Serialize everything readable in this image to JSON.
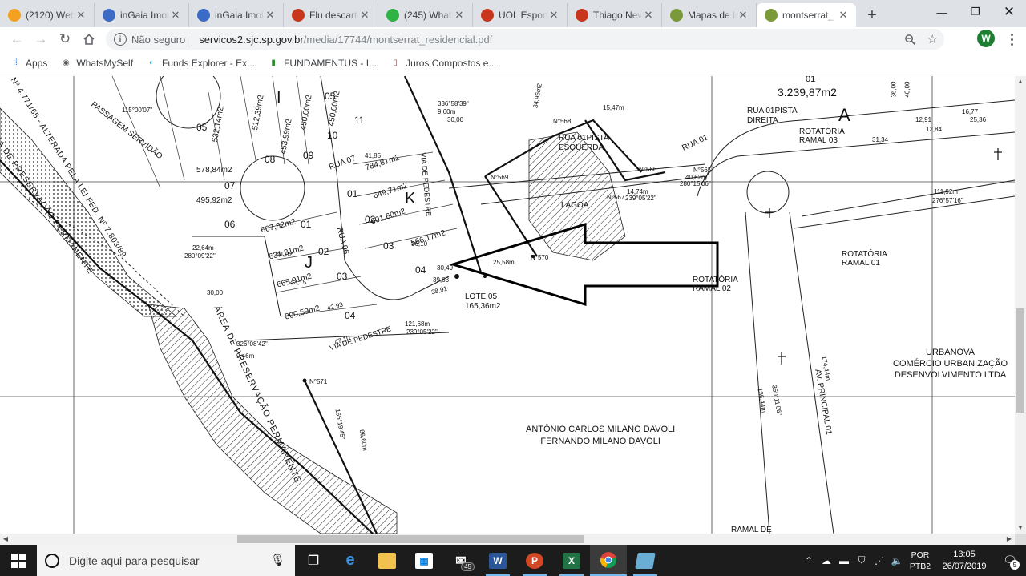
{
  "tabs": [
    {
      "title": "(2120) Web",
      "icon": "mail-icon",
      "color": "#f4a020"
    },
    {
      "title": "inGaia Imob",
      "icon": "ingaia-icon",
      "color": "#3b6bc4"
    },
    {
      "title": "inGaia Imob",
      "icon": "ingaia-icon",
      "color": "#3b6bc4"
    },
    {
      "title": "Flu descarta",
      "icon": "uol-icon",
      "color": "#c8361e"
    },
    {
      "title": "(245) Whats",
      "icon": "whatsapp-icon",
      "color": "#2fb344"
    },
    {
      "title": "UOL Esporte",
      "icon": "uol-icon",
      "color": "#c8361e"
    },
    {
      "title": "Thiago Neve",
      "icon": "uol-icon",
      "color": "#c8361e"
    },
    {
      "title": "Mapas de lo",
      "icon": "map-icon",
      "color": "#7a9a3a"
    },
    {
      "title": "montserrat_",
      "icon": "pdf-map-icon",
      "color": "#7a9a3a",
      "active": true
    }
  ],
  "omnibox": {
    "security": "Não seguro",
    "host": "servicos2.sjc.sp.gov.br",
    "path": "/media/17744/montserrat_residencial.pdf"
  },
  "profile_initial": "W",
  "bookmarks": [
    {
      "label": "Apps",
      "icon": "apps-grid-icon"
    },
    {
      "label": "WhatsMySelf",
      "icon": "whatsmyself-icon"
    },
    {
      "label": "Funds Explorer - Ex...",
      "icon": "funds-explorer-icon"
    },
    {
      "label": "FUNDAMENTUS - I...",
      "icon": "fundamentus-icon"
    },
    {
      "label": "Juros Compostos e...",
      "icon": "juros-icon"
    }
  ],
  "plan": {
    "area_top": "3.239,87m2",
    "label_01": "01",
    "block_A": "A",
    "block_I": "I",
    "block_J": "J",
    "block_K": "K",
    "rua01_pista_direita": "RUA 01PISTA\nDIREITA",
    "rua01_pista_esquerda": "RUA 01PISTA\nESQUERDA",
    "rua07": "RUA 07",
    "rua01": "RUA 01",
    "rua06": "RUA 06",
    "rotatoria_ramal03": "ROTATÓRIA\nRAMAL 03",
    "rotatoria_ramal01": "ROTATÓRIA\nRAMAL 01",
    "rotatoria_ramal02": "ROTATÓRIA\nRAMAL 02",
    "ramal_de": "RAMAL DE",
    "lagoa": "LAGOA",
    "lote05": "LOTE 05\n165,36m2",
    "urbanova": "URBANOVA\nCOMÉRCIO URBANIZAÇÃO\nDESENVOLVIMENTO LTDA",
    "owners": "ANTÔNIO CARLOS MILANO DAVOLI\nFERNANDO MILANO DAVOLI",
    "area_preservacao_1": "ÁREA DE PRESERVAÇÃO PERMANENTE",
    "area_preservacao_2": "ÁREA DE PRESERVAÇÃO PERMANENTE",
    "lei_fed": "Nº 4.771/65 - ALTERADA PELA LEI FED. Nº 7.803/89",
    "passagem": "PASSAGEM SERVIDÃO",
    "av_principal": "AV. PRINCIPAL 01",
    "via_pedestre_1": "VIA DE PEDESTRE",
    "via_pedestre_2": "VIA DE PEDESTRE",
    "lot_areas": [
      "578,84m2",
      "495,92m2",
      "532,14m2",
      "512,39m2",
      "450,00m2",
      "450,00m2",
      "453,99m2",
      "784,81m2",
      "649,71m2",
      "601,60m2",
      "566,17m2",
      "667,82m2",
      "631,31m2",
      "665,91m2",
      "800,59m2"
    ],
    "lot_numbers": [
      "05",
      "07",
      "06",
      "10",
      "09",
      "08",
      "11",
      "01",
      "02",
      "03",
      "04",
      "01",
      "02",
      "03",
      "04",
      "05"
    ],
    "marcos": [
      "N°568",
      "N°569",
      "N°570",
      "N°571",
      "N°566",
      "N°565",
      "N°567"
    ],
    "dims": [
      "3.239,87m2",
      "34,96m2",
      "111,92m",
      "276°57'16\"",
      "115°00'07\"",
      "280°09'22\"",
      "22,64m",
      "30,00",
      "326°08'42\"",
      "9,46m",
      "121,68m",
      "239°05'22\"",
      "25,58m",
      "165°19'45\"",
      "86,60m",
      "136,44m",
      "350°11'06\"",
      "174,44m",
      "40,62m",
      "280°15'06\"",
      "14,74m",
      "239°05'22\"",
      "15,47m",
      "336°58'39\"",
      "9,60m",
      "30,00",
      "36,00",
      "40,00",
      "12,91",
      "12,84",
      "16,77",
      "25,36",
      "31,34",
      "41,85",
      "47,10",
      "42,93",
      "43,15",
      "41,02",
      "38,91",
      "36,10",
      "30,49",
      "39,63"
    ]
  },
  "taskbar": {
    "search_placeholder": "Digite aqui para pesquisar",
    "mail_badge": "45",
    "lang_1": "POR",
    "lang_2": "PTB2",
    "time": "13:05",
    "date": "26/07/2019",
    "notif_count": "5"
  }
}
